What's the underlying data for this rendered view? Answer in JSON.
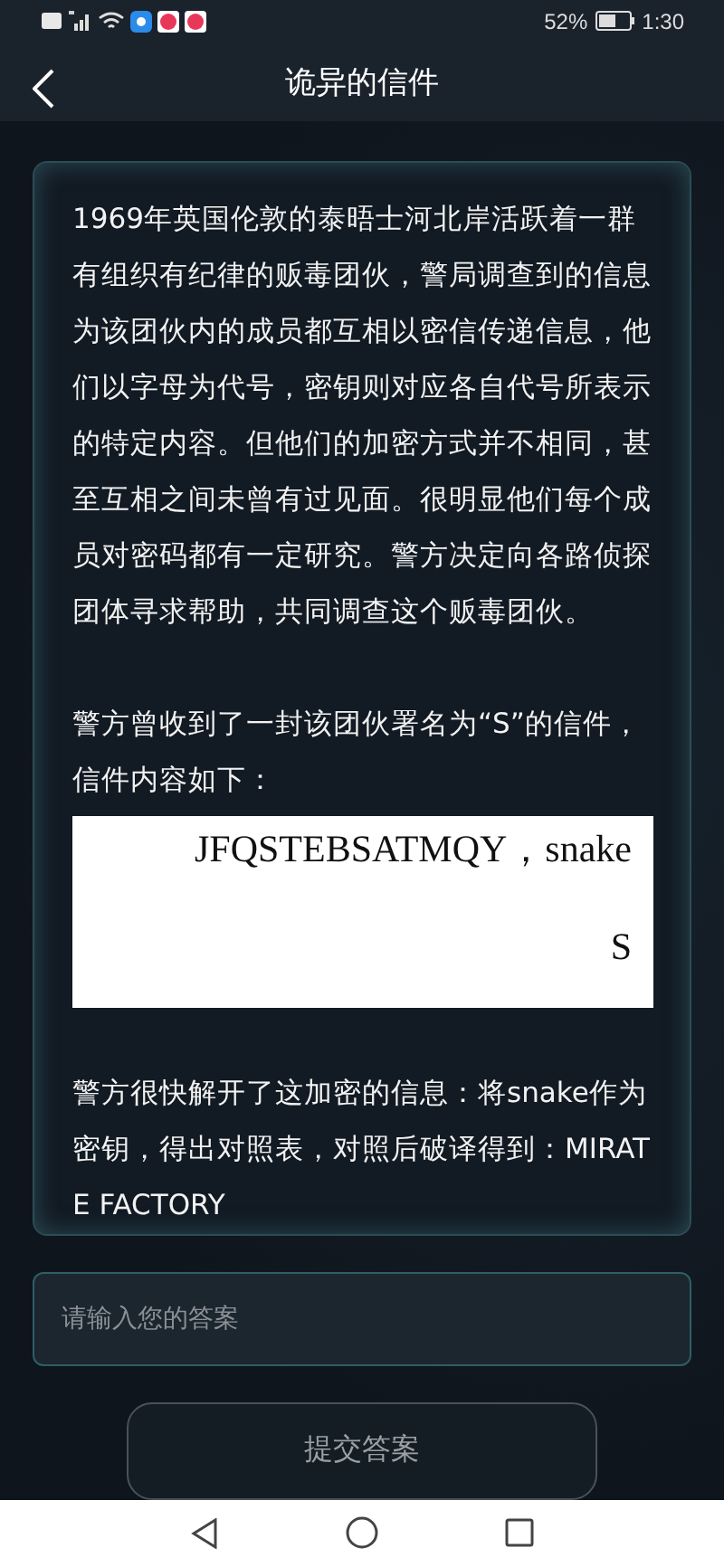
{
  "status_bar": {
    "battery_percent": "52%",
    "time": "1:30"
  },
  "header": {
    "title": "诡异的信件"
  },
  "card": {
    "paragraphs": [
      "1969年英国伦敦的泰晤士河北岸活跃着一群有组织有纪律的贩毒团伙，警局调查到的信息为该团伙内的成员都互相以密信传递信息，他们以字母为代号，密钥则对应各自代号所表示的特定内容。但他们的加密方式并不相同，甚至互相之间未曾有过见面。很明显他们每个成员对密码都有一定研究。警方决定向各路侦探团体寻求帮助，共同调查这个贩毒团伙。",
      "警方曾收到了一封该团伙署名为“S”的信件，信件内容如下："
    ],
    "letter": {
      "message": "JFQSTEBSATMQY，snake",
      "signature": "S"
    },
    "solution": "警方很快解开了这加密的信息：将snake作为密钥，得出对照表，对照后破译得到：MIRATE FACTORY"
  },
  "answer": {
    "placeholder": "请输入您的答案"
  },
  "submit_button": {
    "label": "提交答案"
  }
}
